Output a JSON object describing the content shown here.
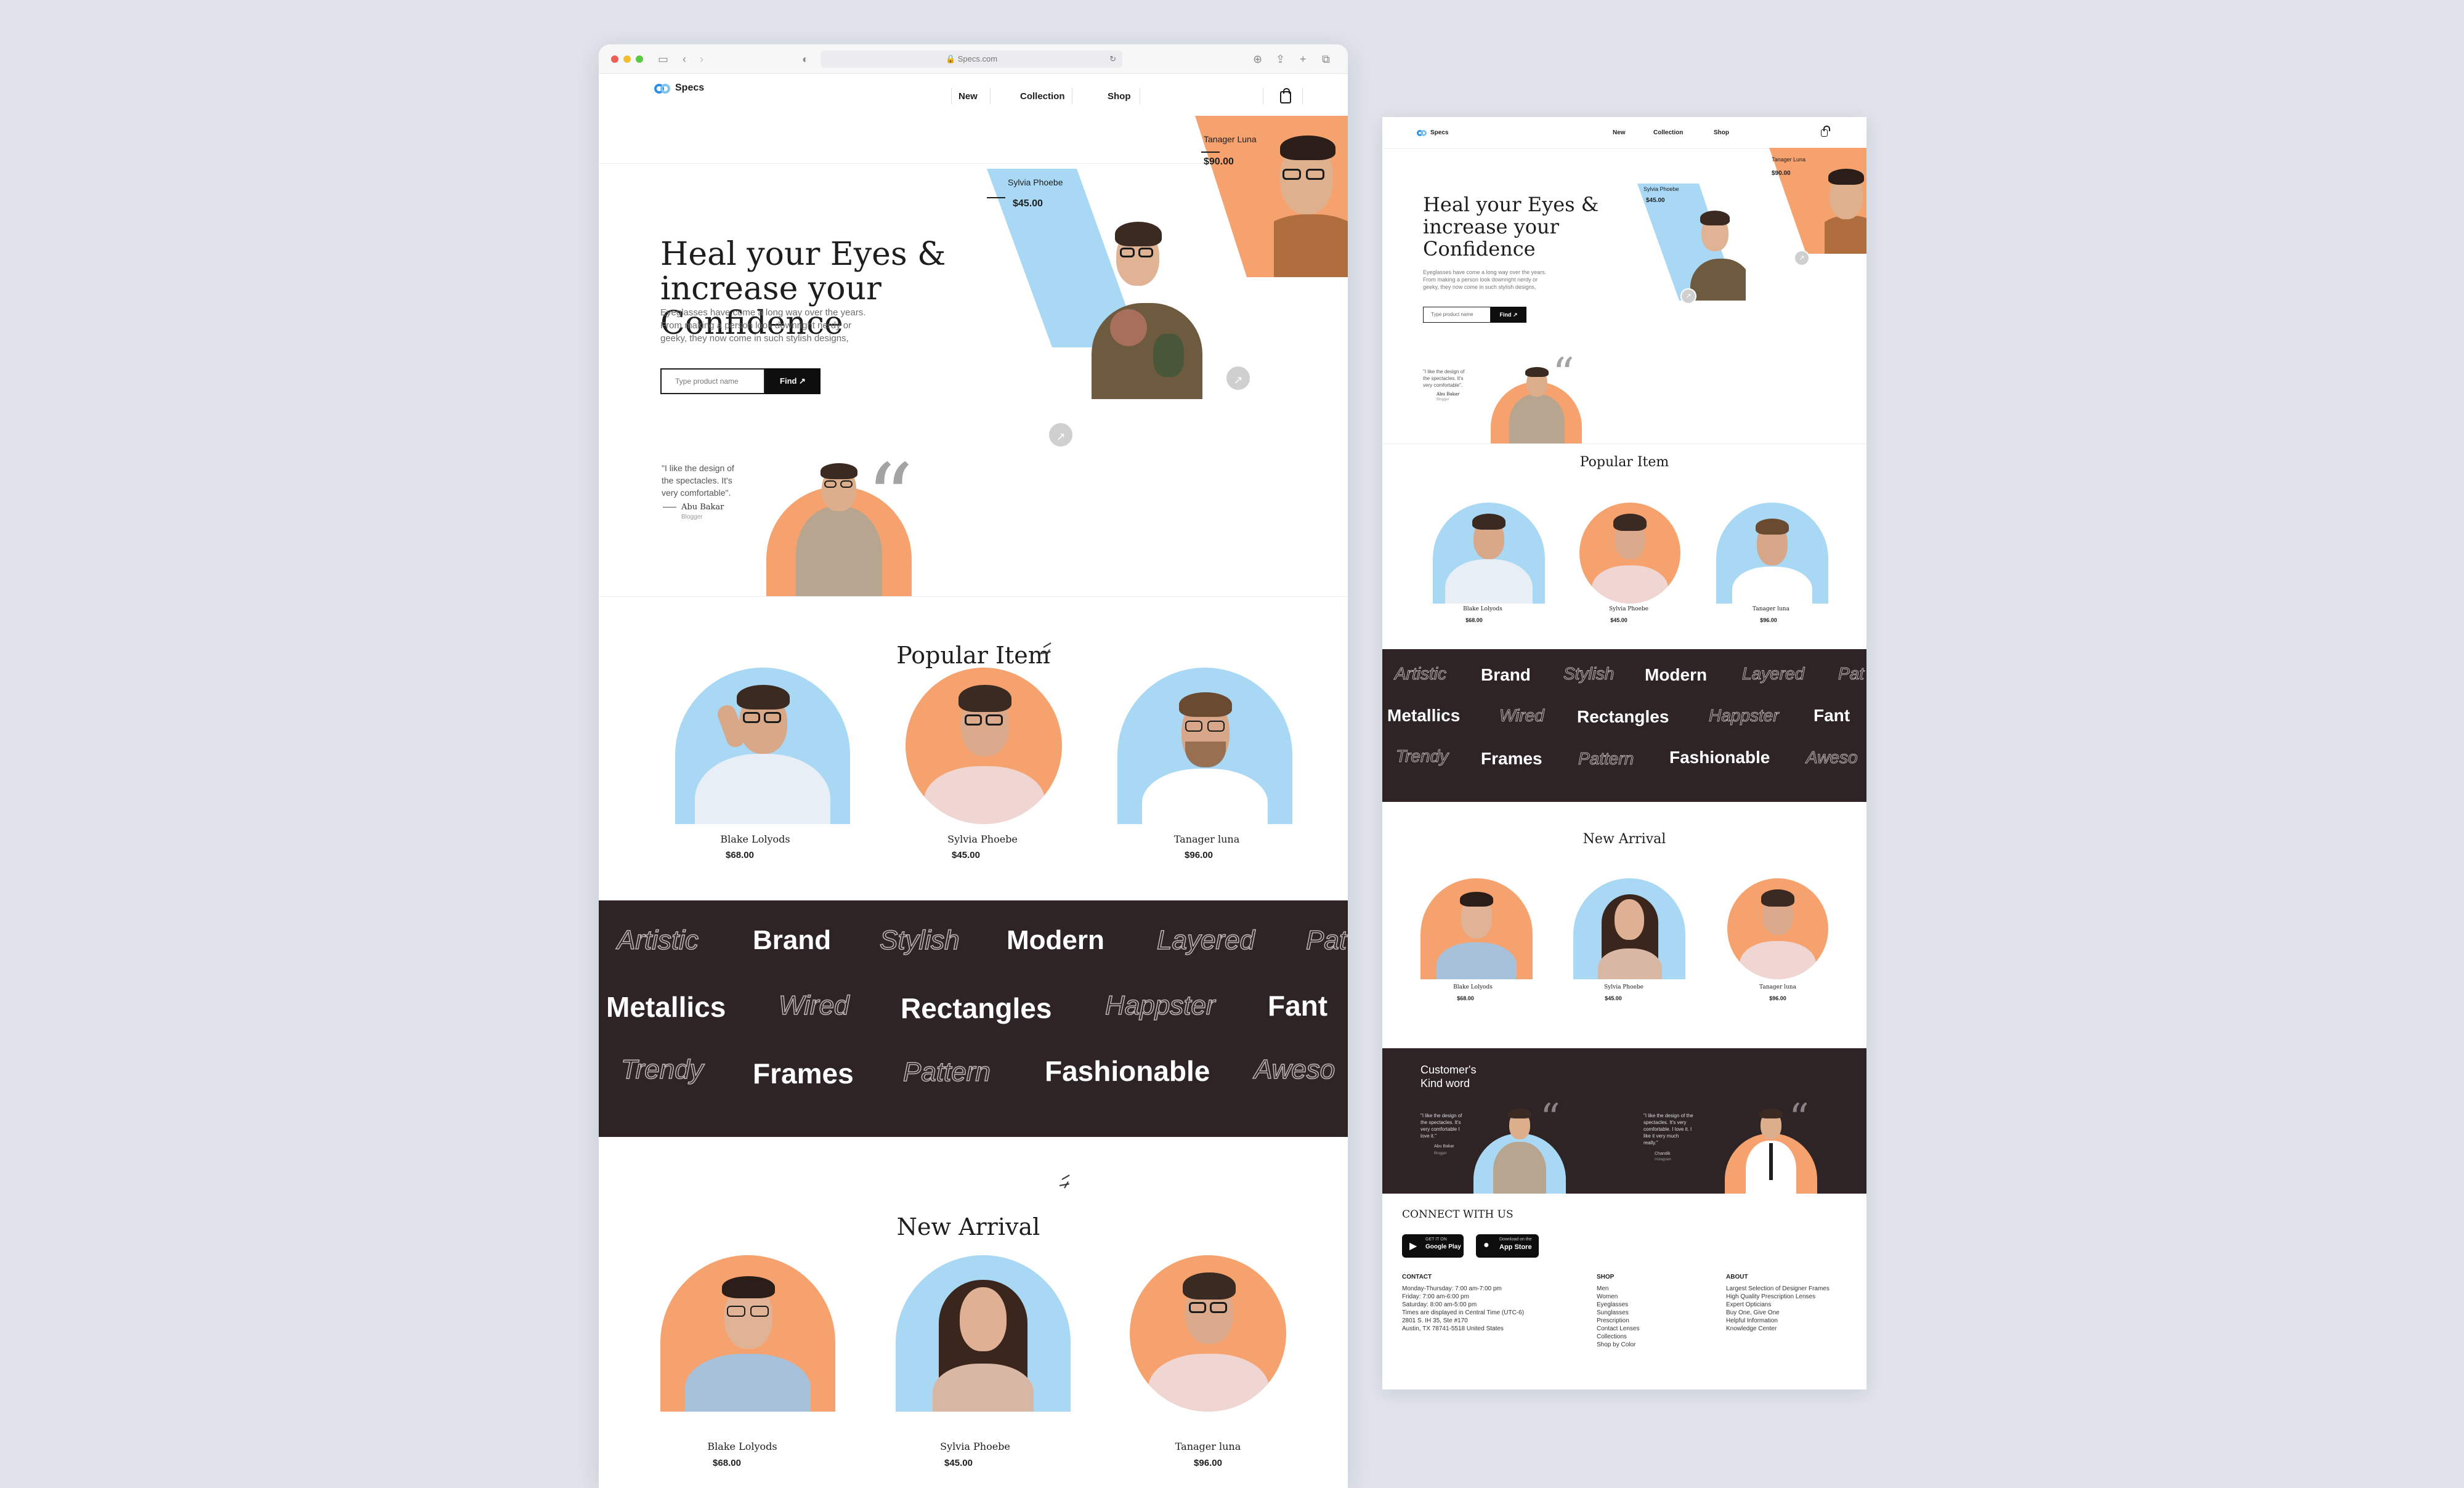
{
  "browser": {
    "url": "Specs.com",
    "brand": "Specs",
    "nav": [
      "New",
      "Collection",
      "Shop"
    ]
  },
  "hero": {
    "title_lines": [
      "Heal your Eyes &",
      "increase your",
      "Confidence"
    ],
    "description_lines": [
      "Eyeglasses have come a long way over the years.",
      "From making a person look downright nerdy or",
      "geeky, they now come in such stylish designs,"
    ],
    "search_placeholder": "Type product name",
    "find_label": "Find ↗",
    "card_blue": {
      "name": "Sylvia Phoebe",
      "price": "$45.00"
    },
    "card_orange": {
      "name": "Tanager Luna",
      "price": "$90.00"
    },
    "quote": {
      "lines": [
        "\"I like the design of",
        "the spectacles. It's",
        "very comfortable\"."
      ],
      "author": "Abu Bakar",
      "role": "Blogger"
    }
  },
  "popular": {
    "title": "Popular Item",
    "items": [
      {
        "name": "Blake Lolyods",
        "price": "$68.00"
      },
      {
        "name": "Sylvia Phoebe",
        "price": "$45.00"
      },
      {
        "name": "Tanager luna",
        "price": "$96.00"
      }
    ]
  },
  "band": {
    "row1": [
      "Artistic",
      "Brand",
      "Stylish",
      "Modern",
      "Layered",
      "Pat"
    ],
    "row2": [
      "Metallics",
      "Wired",
      "Rectangles",
      "Happster",
      "Fant"
    ],
    "row3": [
      "Trendy",
      "Frames",
      "Pattern",
      "Fashionable",
      "Aweso"
    ]
  },
  "arrival": {
    "title": "New Arrival",
    "items": [
      {
        "name": "Blake Lolyods",
        "price": "$68.00"
      },
      {
        "name": "Sylvia Phoebe",
        "price": "$45.00"
      },
      {
        "name": "Tanager luna",
        "price": "$96.00"
      }
    ]
  },
  "mock": {
    "customers_title": [
      "Customer's",
      "Kind word"
    ],
    "testimonial_1": [
      "\"I like the design of",
      "the spectacles. It's",
      "very comfortable I",
      "love it.\""
    ],
    "testimonial_1_author": "Abu Bakar",
    "testimonial_1_role": "Blogger",
    "testimonial_2": [
      "\"I like the design of the",
      "spectacles. It's very",
      "comfortable. I love it. I",
      "like it very much",
      "really.\""
    ],
    "testimonial_2_author": "Chandik",
    "testimonial_2_role": "Instagram",
    "connect": "CONNECT WITH US",
    "google_small": "GET IT ON",
    "google": "Google Play",
    "apple_small": "Download on the",
    "apple": "App Store",
    "footer": {
      "contact_h": "CONTACT",
      "contact": [
        "Monday-Thursday: 7:00 am-7:00 pm",
        "Friday: 7:00 am-6:00 pm",
        "Saturday: 8:00 am-5:00 pm",
        "Times are displayed in Central Time (UTC-6)",
        "2801 S. IH 35, Ste #170",
        "Austin, TX  78741-5518   United States"
      ],
      "shop_h": "SHOP",
      "shop": [
        "Men",
        "Women",
        "Eyeglasses",
        "Sunglasses",
        "Prescription",
        "Contact Lenses",
        "Collections",
        "Shop by Color"
      ],
      "about_h": "ABOUT",
      "about": [
        "Largest Selection of Designer Frames",
        "High Quality Prescription Lenses",
        "Expert Opticians",
        "Buy One, Give One",
        "Helpful Information",
        "Knowledge Center"
      ]
    }
  },
  "colors": {
    "blue": "#a9d8f5",
    "orange": "#f6a26e",
    "dark_band": "#2e2426",
    "accent_logo": "#2f8fe0"
  }
}
